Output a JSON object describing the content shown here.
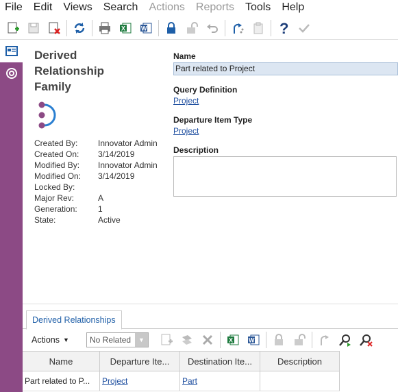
{
  "menu": {
    "items": [
      {
        "label": "File",
        "enabled": true
      },
      {
        "label": "Edit",
        "enabled": true
      },
      {
        "label": "Views",
        "enabled": true
      },
      {
        "label": "Search",
        "enabled": true
      },
      {
        "label": "Actions",
        "enabled": false
      },
      {
        "label": "Reports",
        "enabled": false
      },
      {
        "label": "Tools",
        "enabled": true
      },
      {
        "label": "Help",
        "enabled": true
      }
    ]
  },
  "toolbar": {
    "icons": [
      "new-icon",
      "save-icon",
      "discard-icon",
      "refresh-icon",
      "print-icon",
      "excel-icon",
      "word-icon",
      "lock-icon",
      "unlock-icon",
      "undo-icon",
      "promote-icon",
      "paste-icon",
      "help-icon",
      "done-icon"
    ]
  },
  "form": {
    "title_lines": [
      "Derived",
      "Relationship",
      "Family"
    ],
    "meta": [
      {
        "k": "Created By:",
        "v": "Innovator Admin"
      },
      {
        "k": "Created On:",
        "v": "3/14/2019"
      },
      {
        "k": "Modified By:",
        "v": "Innovator Admin"
      },
      {
        "k": "Modified On:",
        "v": "3/14/2019"
      },
      {
        "k": "Locked By:",
        "v": ""
      },
      {
        "k": "Major Rev:",
        "v": "A"
      },
      {
        "k": "Generation:",
        "v": "1"
      },
      {
        "k": "State:",
        "v": "Active"
      }
    ],
    "name_label": "Name",
    "name_value": "Part related to Project",
    "query_label": "Query Definition",
    "query_value": "Project",
    "departure_label": "Departure Item Type",
    "departure_value": "Project",
    "description_label": "Description",
    "description_value": ""
  },
  "relationships": {
    "tab_label": "Derived Relationships",
    "actions_label": "Actions",
    "select_value": "No Related",
    "columns": [
      "Name",
      "Departure Ite...",
      "Destination Ite...",
      "Description"
    ],
    "rows": [
      {
        "name": "Part related to P...",
        "departure": "Project",
        "destination": "Part",
        "description": ""
      }
    ]
  },
  "colors": {
    "sidebar": "#8c4a85",
    "accent": "#1f5fa8"
  }
}
